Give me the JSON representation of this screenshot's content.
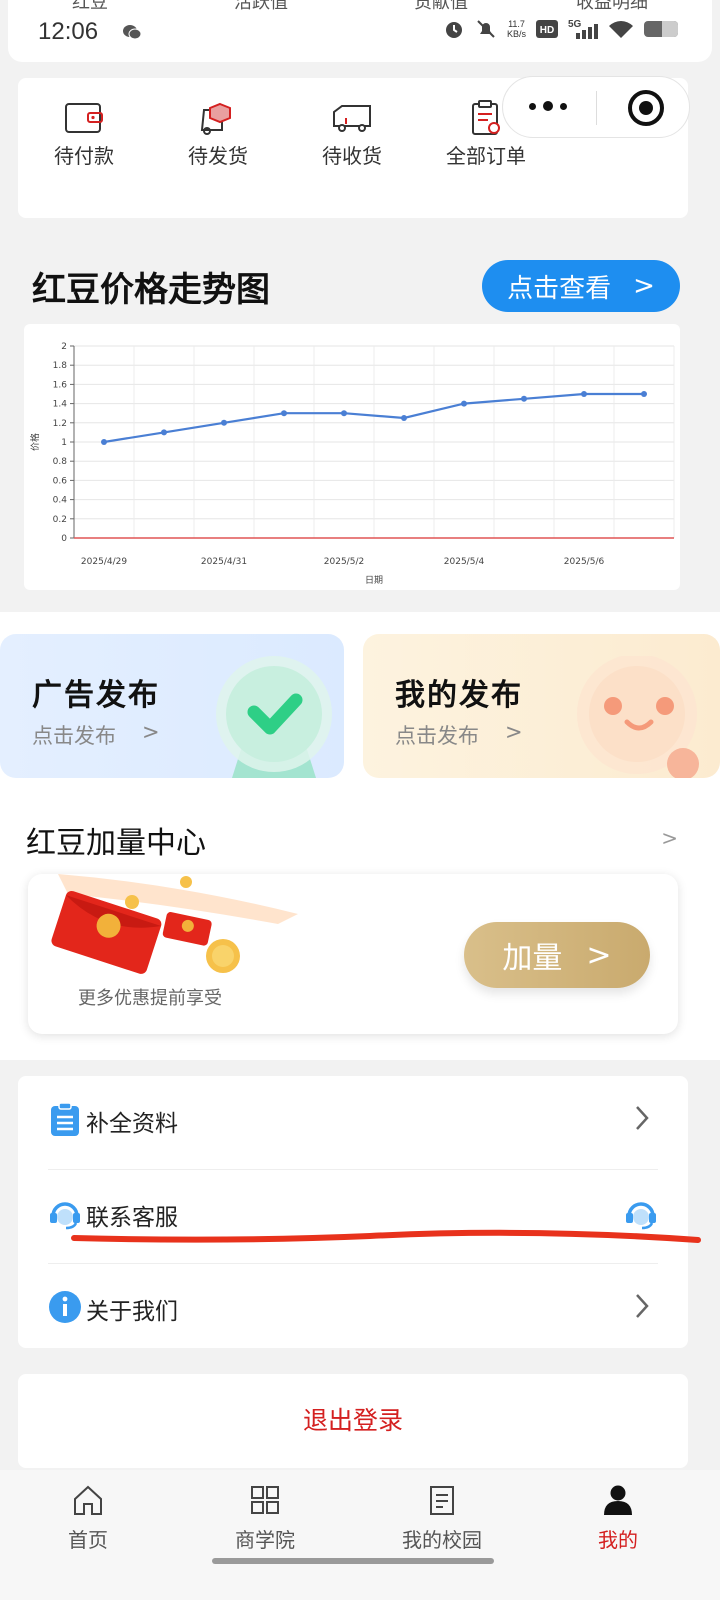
{
  "status_bar": {
    "cut_labels": [
      "红豆",
      "活跃值",
      "贡献值",
      "收益明细"
    ],
    "time": "12:06",
    "net_speed_value": "11.7",
    "net_speed_unit": "KB/s",
    "hd_label": "HD",
    "signal_label": "5G"
  },
  "orders": [
    {
      "label": "待付款",
      "icon": "wallet-icon"
    },
    {
      "label": "待发货",
      "icon": "shipping-box-icon"
    },
    {
      "label": "待收货",
      "icon": "truck-icon"
    },
    {
      "label": "全部订单",
      "icon": "order-list-icon"
    }
  ],
  "trend": {
    "title": "红豆价格走势图",
    "view_button": "点击查看",
    "view_arrow": ">"
  },
  "chart_data": {
    "type": "line",
    "x": [
      "2025/4/29",
      "2025/4/30",
      "2025/4/31",
      "2025/5/1",
      "2025/5/2",
      "2025/5/3",
      "2025/5/4",
      "2025/5/5",
      "2025/5/6",
      "2025/5/7"
    ],
    "values": [
      1.0,
      1.1,
      1.2,
      1.3,
      1.3,
      1.25,
      1.4,
      1.45,
      1.5,
      1.5
    ],
    "x_tick_labels": [
      "2025/4/29",
      "2025/4/31",
      "2025/5/2",
      "2025/5/4",
      "2025/5/6"
    ],
    "y_ticks": [
      "0",
      "0.2",
      "0.4",
      "0.6",
      "0.8",
      "1",
      "1.2",
      "1.4",
      "1.6",
      "1.8",
      "2"
    ],
    "ylim": [
      0,
      2
    ],
    "xlabel": "日期",
    "ylabel": "价格",
    "grid": true,
    "line_color": "#4a7fd4",
    "axis_color": "#e05555"
  },
  "promos": [
    {
      "title": "广告发布",
      "sub": "点击发布",
      "arrow": ">"
    },
    {
      "title": "我的发布",
      "sub": "点击发布",
      "arrow": ">"
    }
  ],
  "boost": {
    "title": "红豆加量中心",
    "more": ">",
    "caption": "更多优惠提前享受",
    "button": "加量",
    "button_arrow": ">"
  },
  "menu": [
    {
      "label": "补全资料",
      "icon": "clipboard-icon"
    },
    {
      "label": "联系客服",
      "icon": "headset-icon"
    },
    {
      "label": "关于我们",
      "icon": "info-icon"
    }
  ],
  "logout": "退出登录",
  "tabs": [
    {
      "label": "首页",
      "icon": "home-icon",
      "active": false
    },
    {
      "label": "商学院",
      "icon": "grid-icon",
      "active": false
    },
    {
      "label": "我的校园",
      "icon": "document-icon",
      "active": false
    },
    {
      "label": "我的",
      "icon": "person-icon",
      "active": true
    }
  ],
  "colors": {
    "accent_blue": "#1e8ef0",
    "logout_red": "#d42020",
    "gold": "#c9aa6e"
  }
}
